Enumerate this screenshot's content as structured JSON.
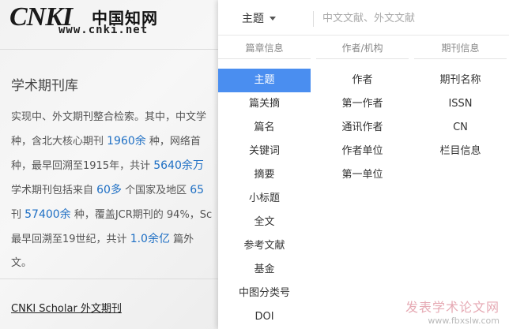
{
  "logo": {
    "mark": "CNKI",
    "chinese": "中国知网",
    "url": "www.cnki.net"
  },
  "library": {
    "title": "学术期刊库",
    "desc": [
      [
        {
          "t": "实现中、外文期刊整合检索。其中，中文学"
        }
      ],
      [
        {
          "t": "种，含北大核心期刊 "
        },
        {
          "t": "1960余",
          "h": true
        },
        {
          "t": " 种，网络首"
        }
      ],
      [
        {
          "t": "种，最早回溯至1915年，共计 "
        },
        {
          "t": "5640余万",
          "h": true
        }
      ],
      [
        {
          "t": "学术期刊包括来自 "
        },
        {
          "t": "60多",
          "h": true
        },
        {
          "t": " 个国家及地区 "
        },
        {
          "t": "65",
          "h": true
        }
      ],
      [
        {
          "t": "刊 "
        },
        {
          "t": "57400余",
          "h": true
        },
        {
          "t": " 种，覆盖JCR期刊的 94%，Sc"
        }
      ],
      [
        {
          "t": "最早回溯至19世纪，共计 "
        },
        {
          "t": "1.0余亿",
          "h": true
        },
        {
          "t": " 篇外"
        }
      ],
      [
        {
          "t": "文。"
        }
      ]
    ],
    "scholar_link": "CNKI Scholar 外文期刊"
  },
  "search": {
    "field_label": "主题",
    "placeholder": "中文文献、外文文献"
  },
  "columns": [
    {
      "header": "篇章信息",
      "items": [
        "主题",
        "篇关摘",
        "篇名",
        "关键词",
        "摘要",
        "小标题",
        "全文",
        "参考文献",
        "基金",
        "中图分类号",
        "DOI"
      ],
      "active_index": 0
    },
    {
      "header": "作者/机构",
      "items": [
        "作者",
        "第一作者",
        "通讯作者",
        "作者单位",
        "第一单位"
      ],
      "active_index": -1
    },
    {
      "header": "期刊信息",
      "items": [
        "期刊名称",
        "ISSN",
        "CN",
        "栏目信息"
      ],
      "active_index": -1
    }
  ],
  "watermark": {
    "line1": "发表学术论文网",
    "line2": "www.fbxslw.com"
  },
  "colors": {
    "accent": "#4a8ef0",
    "highlight_text": "#1e6fc4"
  }
}
